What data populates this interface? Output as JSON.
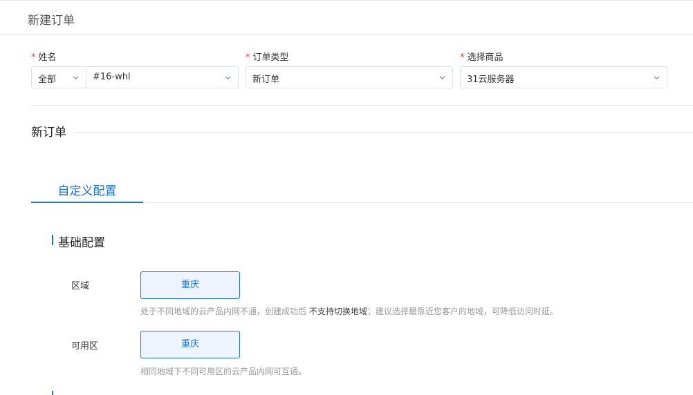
{
  "header": {
    "title": "新建订单"
  },
  "form": {
    "name": {
      "label": "姓名",
      "scope": "全部",
      "value": "#16-whl"
    },
    "order_type": {
      "label": "订单类型",
      "value": "新订单"
    },
    "product": {
      "label": "选择商品",
      "value": "31云服务器"
    },
    "required_mark": "*"
  },
  "section": {
    "title": "新订单"
  },
  "tabs": [
    {
      "label": "自定义配置",
      "active": true
    }
  ],
  "basic": {
    "title": "基础配置",
    "region": {
      "label": "区域",
      "option": "重庆",
      "help_prefix": "处于不同地域的云产品内网不通，创建成功后",
      "help_strong": "不支持切换地域",
      "help_suffix": "；建议选择最靠近您客户的地域，可降低访问时延。"
    },
    "zone": {
      "label": "可用区",
      "option": "重庆",
      "help": "相同地域下不同可用区的云产品内网可互通。"
    }
  },
  "colors": {
    "accent": "#1e6fd9",
    "required": "#e54d42"
  },
  "icons": {
    "dropdown": "chevron-down-icon"
  }
}
